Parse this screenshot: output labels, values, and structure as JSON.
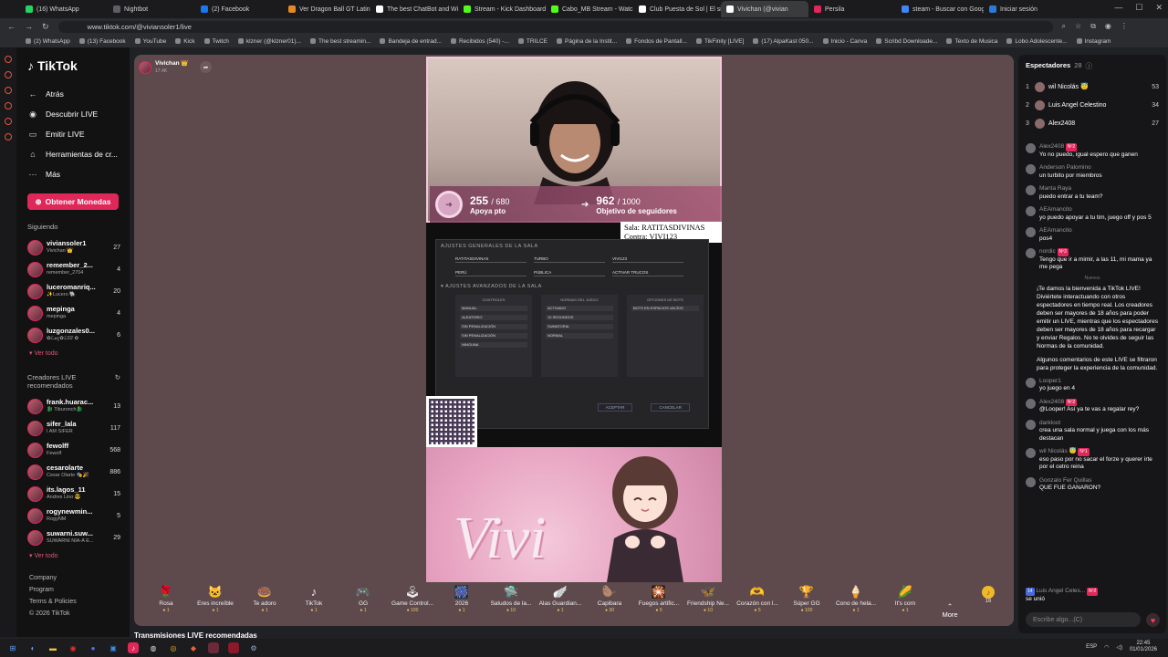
{
  "browser": {
    "tabs": [
      {
        "label": "(16) WhatsApp",
        "color": "#25d366"
      },
      {
        "label": "Nightbot",
        "color": "#5e5e66"
      },
      {
        "label": "(2) Facebook",
        "color": "#1877f2"
      },
      {
        "label": "Ver Dragon Ball GT Latino",
        "color": "#e58a23"
      },
      {
        "label": "The best ChatBot and Wi",
        "color": "#ffffff"
      },
      {
        "label": "Stream - Kick Dashboard",
        "color": "#53fc18"
      },
      {
        "label": "Cabo_MB Stream - Watch",
        "color": "#53fc18"
      },
      {
        "label": "Club Puesta de Sol | El si",
        "color": "#ffffff"
      },
      {
        "label": "Vivichan (@vivian",
        "color": "#ffffff"
      },
      {
        "label": "Persila",
        "color": "#e0275a"
      },
      {
        "label": "steam - Buscar con Goog",
        "color": "#4285f4"
      },
      {
        "label": "Iniciar sesión",
        "color": "#2a7bd8"
      }
    ],
    "active_tab_index": 8,
    "url": "www.tiktok.com/@viviansoler1/live",
    "bookmarks": [
      "(2) WhatsApp",
      "(13) Facebook",
      "YouTube",
      "Kick",
      "Twitch",
      "klzner (@klzner01)...",
      "The best streamin...",
      "Bandeja de entrad...",
      "Recibidos (540) -...",
      "TRILCE",
      "Página de la Instit...",
      "Fondos de Pantall...",
      "TikFinity [LIVE]",
      "(17) AlpaKast 050...",
      "Inicio - Canva",
      "Scribd Downloade...",
      "Texto de Musica",
      "Lobo Adolescente...",
      "Instagram"
    ]
  },
  "sidebar": {
    "logo": "TikTok",
    "back_label": "Atrás",
    "nav": [
      {
        "label": "Descubrir LIVE",
        "icon": "live-icon"
      },
      {
        "label": "Emitir LIVE",
        "icon": "camera-icon"
      },
      {
        "label": "Herramientas de cr...",
        "icon": "home-icon"
      },
      {
        "label": "Más",
        "icon": "more-icon"
      }
    ],
    "coins_label": "Obtener Monedas",
    "following_title": "Siguiendo",
    "following": [
      {
        "name": "viviansoler1",
        "sub": "Vivichan 👑",
        "count": "27"
      },
      {
        "name": "remember_2...",
        "sub": "remember_2704",
        "count": "4"
      },
      {
        "name": "luceromanriq...",
        "sub": "✨Lucero 🐘",
        "count": "20"
      },
      {
        "name": "mepinga",
        "sub": "mepinga",
        "count": "4"
      },
      {
        "name": "luzgonzales0...",
        "sub": "✿ℒ𝓊𝓏✿ℒ02 ✿",
        "count": "6"
      }
    ],
    "see_all": "Ver todo",
    "recommended_title": "Creadores LIVE recomendados",
    "recommended": [
      {
        "name": "frank.huarac...",
        "sub": "🐉 Tiburonch🐉",
        "count": "13"
      },
      {
        "name": "sifer_lala",
        "sub": "I AM SIFER",
        "count": "117"
      },
      {
        "name": "fewolff",
        "sub": "Fewolf",
        "count": "568"
      },
      {
        "name": "cesarolarte",
        "sub": "Cesar Olarte 🎭🎉",
        "count": "886"
      },
      {
        "name": "its.lagos_11",
        "sub": "Andres Lino 😎",
        "count": "15"
      },
      {
        "name": "rogynewmin...",
        "sub": "RogyNM",
        "count": "5"
      },
      {
        "name": "suwarni.suw...",
        "sub": "SUWARNI NIA-A E...",
        "count": "29"
      }
    ],
    "see_all_2": "Ver todo",
    "footer": [
      "Company",
      "Program",
      "Terms & Policies",
      "© 2026 TikTok"
    ]
  },
  "stream": {
    "host_name": "Vivichan 👑",
    "host_likes": "17.4K",
    "goal1_value": "255",
    "goal1_total": "/ 680",
    "goal1_label": "Apoya pto",
    "goal2_value": "962",
    "goal2_total": "/ 1000",
    "goal2_label": "Objetivo de seguidores",
    "sala_line1": "Sala: RATITASDIVINAS",
    "sala_line2": "Contra: VIVI123",
    "dialog": {
      "title": "AJUSTES GENERALES DE LA SALA",
      "row1": [
        "RATITASDIVINAS",
        "TURBO",
        "VIVI123"
      ],
      "row2": [
        "PERÚ",
        "PÚBLICA",
        "ACTIVAR TRUCOS"
      ],
      "advanced_title": "▾ AJUSTES AVANZADOS DE LA SALA",
      "col_heads": [
        "CONTROLES",
        "NORMAS DEL JUEGO",
        "OPCIONES DE BOTS"
      ],
      "col1": [
        "MANUAL",
        "ALEATORIO",
        "SIN PENALIZACIÓN",
        "SIN PENALIZACIÓN",
        "NINGUNA"
      ],
      "col2": [
        "ACTIVADO",
        "10 SEGUNDOS",
        "SUMATORIA",
        "NORMAL"
      ],
      "col3": [
        "BOTS EN ESPACIOS VACÍOS"
      ],
      "accept": "ACEPTAR",
      "cancel": "CANCELAR"
    },
    "art_text": "Vivi"
  },
  "gifts": [
    {
      "name": "Rosa",
      "price": "1",
      "icon": "🌹"
    },
    {
      "name": "Eres increíble",
      "price": "1",
      "icon": "🐱"
    },
    {
      "name": "Te adoro",
      "price": "1",
      "icon": "🍩"
    },
    {
      "name": "TikTok",
      "price": "1",
      "icon": "♪"
    },
    {
      "name": "GG",
      "price": "1",
      "icon": "🎮"
    },
    {
      "name": "Game Control...",
      "price": "100",
      "icon": "🕹"
    },
    {
      "name": "2026",
      "price": "1",
      "icon": "🎆"
    },
    {
      "name": "Saludos de la...",
      "price": "10",
      "icon": "🛸"
    },
    {
      "name": "Alas Guardian...",
      "price": "1",
      "icon": "🪽"
    },
    {
      "name": "Capibara",
      "price": "30",
      "icon": "🦫"
    },
    {
      "name": "Fuegos artific...",
      "price": "5",
      "icon": "🎇"
    },
    {
      "name": "Friendship Ne...",
      "price": "10",
      "icon": "🦋"
    },
    {
      "name": "Corazón con l...",
      "price": "5",
      "icon": "🫶"
    },
    {
      "name": "Súper GG",
      "price": "100",
      "icon": "🏆"
    },
    {
      "name": "Cono de hela...",
      "price": "1",
      "icon": "🍦"
    },
    {
      "name": "It's corn",
      "price": "1",
      "icon": "🌽"
    }
  ],
  "more_label": "More",
  "coin_count": "16",
  "recommended_live_label": "Transmisiones LIVE recomendadas",
  "chat": {
    "viewers_label": "Espectadores",
    "viewers_count": "28",
    "top_viewers": [
      {
        "rank": "1",
        "name": "wil Nicolás 😇",
        "score": "53"
      },
      {
        "rank": "2",
        "name": "Luis Angel Celestino",
        "score": "34"
      },
      {
        "rank": "3",
        "name": "Alex2408",
        "score": "27"
      }
    ],
    "messages": [
      {
        "user": "Alex2408",
        "text": "Yo no puedo, igual espero que ganen",
        "badge": "Nº2"
      },
      {
        "user": "Anderson Palomino",
        "text": "un turbito por miembros",
        "badge": ""
      },
      {
        "user": "Manta Raya",
        "text": "puedo entrar a tu team?",
        "badge": ""
      },
      {
        "user": "AEAmancito",
        "text": "yo puedo apoyar a tu tim, juego off y pos 5",
        "badge": ""
      },
      {
        "user": "AEAmancito",
        "text": "pos4",
        "badge": ""
      },
      {
        "user": "nordic",
        "text": "Tengo que ir a mimir, a las 11, mi mama ya me pega",
        "badge": "Nº3"
      }
    ],
    "divider": "Nuevos",
    "system1": "¡Te damos la bienvenida a TikTok LIVE! Diviértete interactuando con otros espectadores en tiempo real. Los creadores deben ser mayores de 18 años para poder emitir un LIVE, mientras que los espectadores deben ser mayores de 18 años para recargar y enviar Regalos. No te olvides de seguir las Normas de la comunidad.",
    "system2": "Algunos comentarios de este LIVE se filtraron para proteger la experiencia de la comunidad.",
    "messages2": [
      {
        "user": "Looper1",
        "text": "yo juego en 4",
        "badge": ""
      },
      {
        "user": "Alex2408",
        "text": "@Looper! Así ya te vas a regalar rey?",
        "badge": "Nº2"
      },
      {
        "user": "darkloot",
        "text": "crea una sala normal y juega con los más destacan",
        "badge": ""
      },
      {
        "user": "wil Nicolás 😇",
        "text": "eso paso por no sacar el forze y querer irte por el cetro reina",
        "badge": "Nº1"
      },
      {
        "user": "Gonzalo Fer Quillas",
        "text": "QUE FUE GANARON?",
        "badge": ""
      }
    ],
    "joined_user": "Luis Angel Celes...",
    "joined_text": "se unió",
    "input_placeholder": "Escribe algo...(C)"
  },
  "taskbar": {
    "time": "22:45",
    "date": "01/01/2026",
    "lang": "ESP"
  }
}
